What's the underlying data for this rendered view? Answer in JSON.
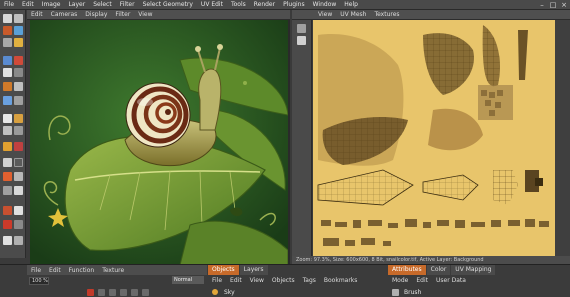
{
  "menubar": {
    "items": [
      "File",
      "Edit",
      "Image",
      "Layer",
      "Select",
      "Filter",
      "Select Geometry",
      "UV Edit",
      "Tools",
      "Render",
      "Plugins",
      "Window",
      "Help"
    ]
  },
  "viewport": {
    "menu": [
      "Edit",
      "Cameras",
      "Display",
      "Filter",
      "View"
    ]
  },
  "uv_editor": {
    "menu": [
      "View",
      "UV Mesh",
      "Textures"
    ],
    "status": "Zoom: 97.3%, Size: 600x600, 8 Bit, snailcolor.tif, Active Layer: Background"
  },
  "timeline": {
    "menu": [
      "File",
      "Edit",
      "Function",
      "Texture"
    ],
    "frame_value": "100 %",
    "mode_value": "Normal"
  },
  "objects_panel": {
    "tabs": [
      "Objects",
      "Layers"
    ],
    "menu": [
      "File",
      "Edit",
      "View",
      "Objects",
      "Tags",
      "Bookmarks"
    ],
    "row_label": "Sky"
  },
  "attributes_panel": {
    "tabs": [
      "Attributes",
      "Color",
      "UV Mapping"
    ],
    "menu": [
      "Mode",
      "Edit",
      "User Data"
    ],
    "row_label": "Brush"
  },
  "colors": {
    "accent_tab": "#c76a2a",
    "viewport_bg": "#2b5a26",
    "uv_bg": "#e6c46a"
  }
}
